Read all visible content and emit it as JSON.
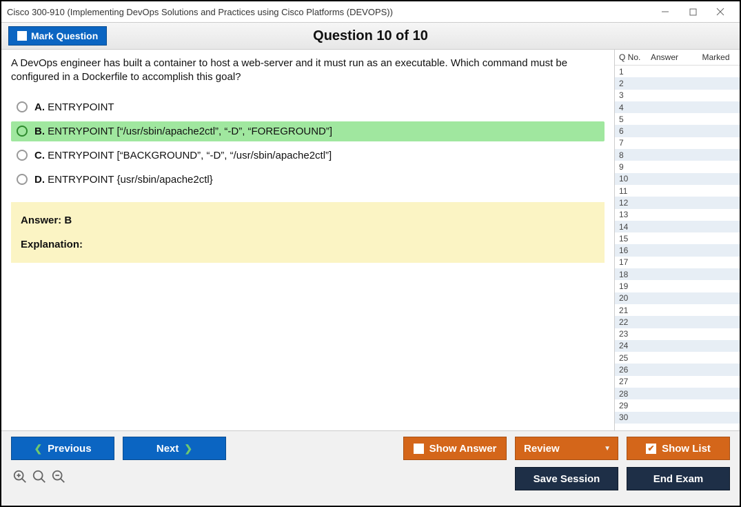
{
  "window_title": "Cisco 300-910 (Implementing DevOps Solutions and Practices using Cisco Platforms (DEVOPS))",
  "header": {
    "mark_label": "Mark Question",
    "question_title": "Question 10 of 10"
  },
  "question": {
    "text": "A DevOps engineer has built a container to host a web-server and it must run as an executable. Which command must be configured in a Dockerfile to accomplish this goal?",
    "options": {
      "a": {
        "letter": "A.",
        "text": "ENTRYPOINT"
      },
      "b": {
        "letter": "B.",
        "text": "ENTRYPOINT [“/usr/sbin/apache2ctl”, “-D”, “FOREGROUND”]"
      },
      "c": {
        "letter": "C.",
        "text": "ENTRYPOINT [“BACKGROUND”, “-D”, “/usr/sbin/apache2ctl”]"
      },
      "d": {
        "letter": "D.",
        "text": "ENTRYPOINT {usr/sbin/apache2ctl}"
      }
    },
    "answer_label": "Answer: B",
    "explanation_label": "Explanation:"
  },
  "nav": {
    "col_qno": "Q No.",
    "col_answer": "Answer",
    "col_marked": "Marked",
    "rows": 30
  },
  "footer": {
    "previous": "Previous",
    "next": "Next",
    "show_answer": "Show Answer",
    "review": "Review",
    "show_list": "Show List",
    "save_session": "Save Session",
    "end_exam": "End Exam"
  }
}
